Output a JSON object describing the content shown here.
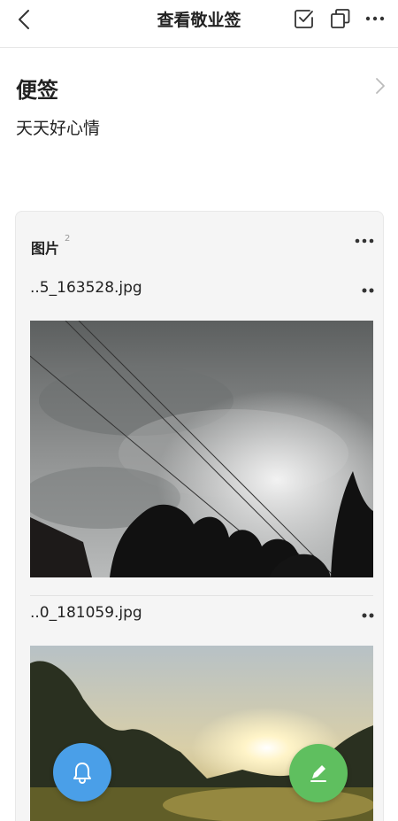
{
  "header": {
    "title": "查看敬业签",
    "back_icon": "chevron-left-icon",
    "actions": [
      "check-square-icon",
      "copy-icon",
      "more-horizontal-icon"
    ]
  },
  "note": {
    "section_title": "便签",
    "text": "天天好心情"
  },
  "images_card": {
    "title": "图片",
    "count": "2",
    "files": [
      {
        "name": "..5_163528.jpg"
      },
      {
        "name": "..0_181059.jpg"
      }
    ]
  },
  "fabs": {
    "reminder_icon": "bell-icon",
    "edit_icon": "pencil-icon"
  },
  "colors": {
    "bell_fab": "#4a9fe8",
    "edit_fab": "#5fbf5f",
    "card_bg": "#f5f5f5"
  }
}
